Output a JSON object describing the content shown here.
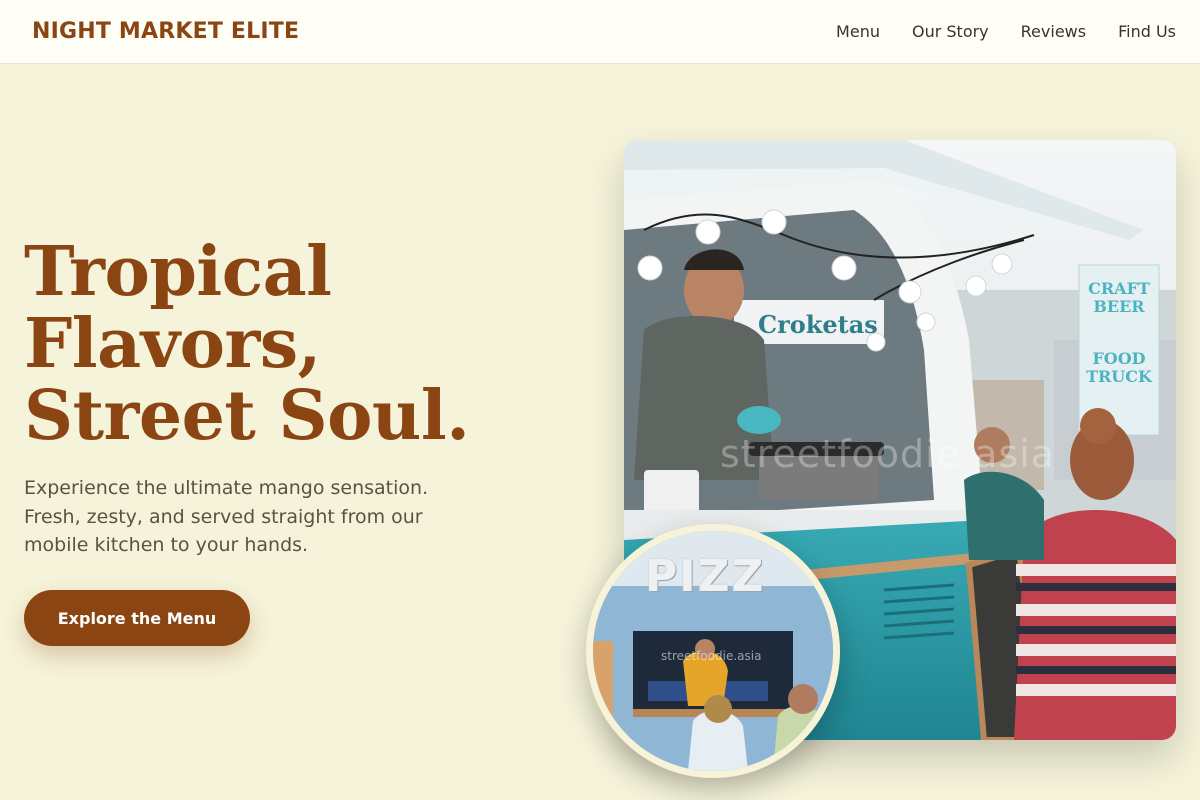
{
  "header": {
    "brand": "NIGHT MARKET ELITE",
    "nav": [
      {
        "label": "Menu"
      },
      {
        "label": "Our Story"
      },
      {
        "label": "Reviews"
      },
      {
        "label": "Find Us"
      }
    ]
  },
  "hero": {
    "title_lines": [
      "Tropical",
      "Flavors,",
      "Street Soul."
    ],
    "subtitle": "Experience the ultimate mango sensation. Fresh, zesty, and served straight from our mobile kitchen to your hands.",
    "cta_label": "Explore the Menu"
  },
  "images": {
    "main_photo": {
      "watermark": "streetfoodie.asia",
      "sign_croketas": "Croketas",
      "sign_craft_beer": "CRAFT BEER",
      "sign_food_truck": "FOOD TRUCK"
    },
    "circle_photo": {
      "sign_text": "PIZZ",
      "watermark": "streetfoodie.asia"
    }
  },
  "colors": {
    "background": "#f5f3d9",
    "header_bg": "#fefdf6",
    "brand": "#8b4513",
    "button_bg": "#8b4513",
    "button_text": "#ffffff",
    "body_text": "#5b5146",
    "truck_teal": "#2a9aa6"
  }
}
